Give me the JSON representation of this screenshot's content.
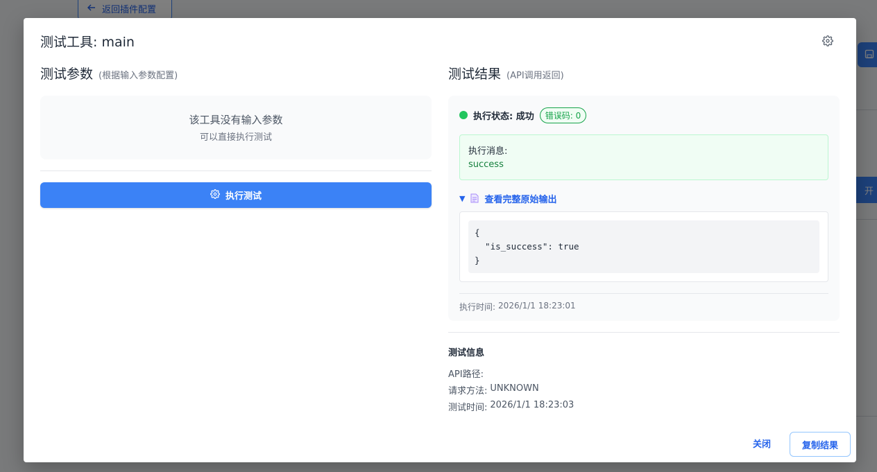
{
  "background": {
    "back_button_label": "返回插件配置",
    "open_button_label": "开"
  },
  "modal": {
    "title": "测试工具: main",
    "settings_icon": "gear-icon"
  },
  "params": {
    "title": "测试参数",
    "subtitle": "(根据输入参数配置)",
    "empty_main": "该工具没有输入参数",
    "empty_sub": "可以直接执行测试",
    "run_button_label": "执行测试"
  },
  "results": {
    "title": "测试结果",
    "subtitle": "(API调用返回)",
    "status_label": "执行状态: 成功",
    "error_code_badge": "错误码: 0",
    "message_label": "执行消息:",
    "message_value": "success",
    "raw_toggle_label": "查看完整原始输出",
    "raw_output": "{\n  \"is_success\": true\n}",
    "exec_time_label": "执行时间:",
    "exec_time_value": "2026/1/1 18:23:01"
  },
  "test_info": {
    "title": "测试信息",
    "api_path_label": "API路径:",
    "api_path_value": "",
    "method_label": "请求方法:",
    "method_value": "UNKNOWN",
    "test_time_label": "测试时间:",
    "test_time_value": "2026/1/1 18:23:03"
  },
  "footer": {
    "close_label": "关闭",
    "copy_label": "复制结果"
  },
  "colors": {
    "primary": "#3b82f6",
    "success": "#22c55e",
    "link": "#2563eb"
  }
}
